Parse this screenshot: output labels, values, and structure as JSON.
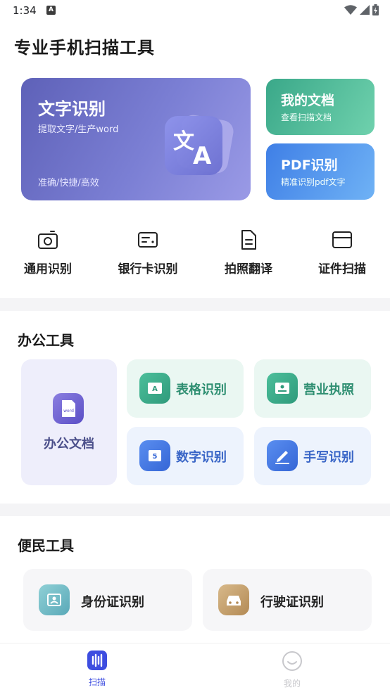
{
  "status_bar": {
    "time": "1:34",
    "notification_icon": "A"
  },
  "app_title": "专业手机扫描工具",
  "hero_card": {
    "title": "文字识别",
    "subtitle": "提取文字/生产word",
    "footer": "准确/快捷/高效",
    "icon": "translate-icon"
  },
  "side_cards": [
    {
      "title": "我的文档",
      "subtitle": "查看扫描文档",
      "color": "#3aa889"
    },
    {
      "title": "PDF识别",
      "subtitle": "精准识别pdf文字",
      "color": "#3f7fe6"
    }
  ],
  "quick_actions": [
    {
      "label": "通用识别",
      "icon": "camera-icon"
    },
    {
      "label": "银行卡识别",
      "icon": "bank-card-icon"
    },
    {
      "label": "拍照翻译",
      "icon": "document-icon"
    },
    {
      "label": "证件扫描",
      "icon": "card-icon"
    }
  ],
  "office_tools": {
    "title": "办公工具",
    "main": {
      "label": "办公文档",
      "icon_text": "word"
    },
    "items": [
      {
        "label": "表格识别",
        "icon_text": "A"
      },
      {
        "label": "营业执照",
        "icon_text": ""
      },
      {
        "label": "数字识别",
        "icon_text": "5"
      },
      {
        "label": "手写识别",
        "icon_text": ""
      }
    ]
  },
  "civil_tools": {
    "title": "便民工具",
    "items": [
      {
        "label": "身份证识别",
        "icon": "id-card-icon"
      },
      {
        "label": "行驶证识别",
        "icon": "car-icon"
      }
    ]
  },
  "tab_bar": {
    "tabs": [
      {
        "label": "扫描",
        "active": true
      },
      {
        "label": "我的",
        "active": false
      }
    ],
    "active_color": "#3d4de0",
    "inactive_color": "#c8c8cc"
  }
}
